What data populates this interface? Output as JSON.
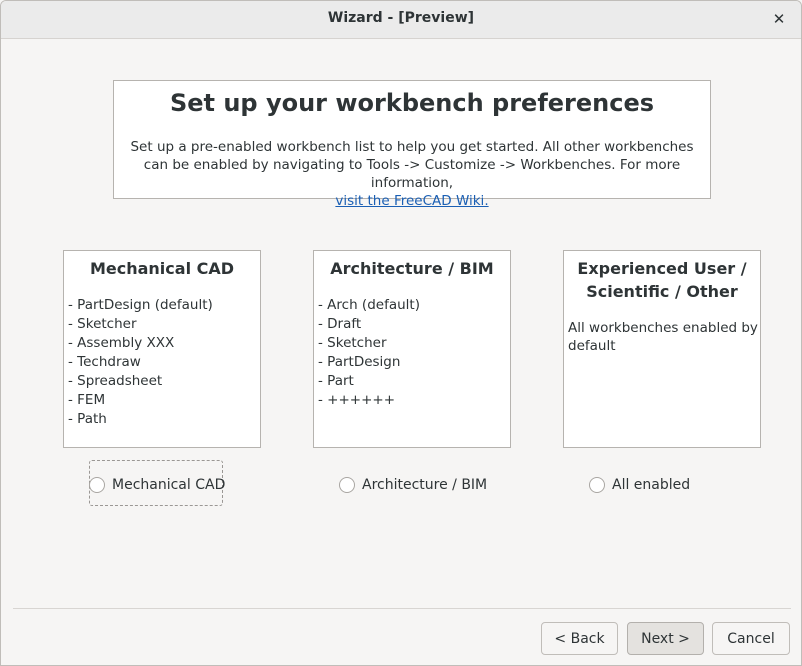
{
  "window": {
    "title": "Wizard - [Preview]"
  },
  "header": {
    "title": "Set up your workbench preferences",
    "description": "Set up a pre-enabled workbench list to help you get started. All other workbenches can be enabled by navigating to Tools -> Customize -> Workbenches. For more information,",
    "link_text": "visit the FreeCAD Wiki."
  },
  "cards": [
    {
      "title": "Mechanical CAD",
      "items": [
        "- PartDesign (default)",
        "- Sketcher",
        "- Assembly XXX",
        "- Techdraw",
        "- Spreadsheet",
        "- FEM",
        "- Path"
      ]
    },
    {
      "title": "Architecture / BIM",
      "items": [
        "- Arch (default)",
        "- Draft",
        "- Sketcher",
        "- PartDesign",
        "- Part",
        "- ++++++"
      ]
    },
    {
      "title": "Experienced User / Scientific / Other",
      "text": "All workbenches enabled by default"
    }
  ],
  "options": [
    "Mechanical CAD",
    "Architecture / BIM",
    "All enabled"
  ],
  "buttons": {
    "back": "< Back",
    "next": "Next >",
    "cancel": "Cancel"
  },
  "icons": {
    "close": "close-icon"
  },
  "colors": {
    "link": "#1a5fb4",
    "window_bg": "#f6f5f4"
  }
}
